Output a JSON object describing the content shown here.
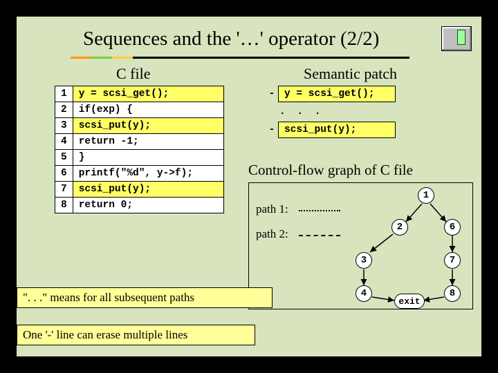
{
  "title": "Sequences and the '…' operator (2/2)",
  "headers": {
    "cfile": "C file",
    "sem": "Semantic patch",
    "cfg": "Control-flow graph of C file"
  },
  "code": {
    "rows": [
      {
        "n": "1",
        "text": "y = scsi_get();",
        "hl": true
      },
      {
        "n": "2",
        "text": "if(exp) {",
        "hl": false
      },
      {
        "n": "3",
        "text": " scsi_put(y);",
        "hl": true
      },
      {
        "n": "4",
        "text": " return -1;",
        "hl": false
      },
      {
        "n": "5",
        "text": "}",
        "hl": false
      },
      {
        "n": "6",
        "text": "printf(\"%d\", y->f);",
        "hl": false
      },
      {
        "n": "7",
        "text": "scsi_put(y);",
        "hl": true
      },
      {
        "n": "8",
        "text": "return 0;",
        "hl": false
      }
    ]
  },
  "sem_patch": {
    "lines": [
      {
        "sign": "-",
        "text": "y = scsi_get();",
        "box": true
      },
      {
        "sign": "",
        "text": ". . .",
        "box": false
      },
      {
        "sign": "-",
        "text": "scsi_put(y);",
        "box": true
      }
    ]
  },
  "cfg": {
    "path1": "path 1:",
    "path2": "path 2:",
    "nodes": [
      "1",
      "2",
      "3",
      "4",
      "6",
      "7",
      "8"
    ],
    "exit": "exit"
  },
  "notes": {
    "n1": "\". . .\" means for all subsequent paths",
    "n2": "One '-' line can erase multiple lines"
  }
}
